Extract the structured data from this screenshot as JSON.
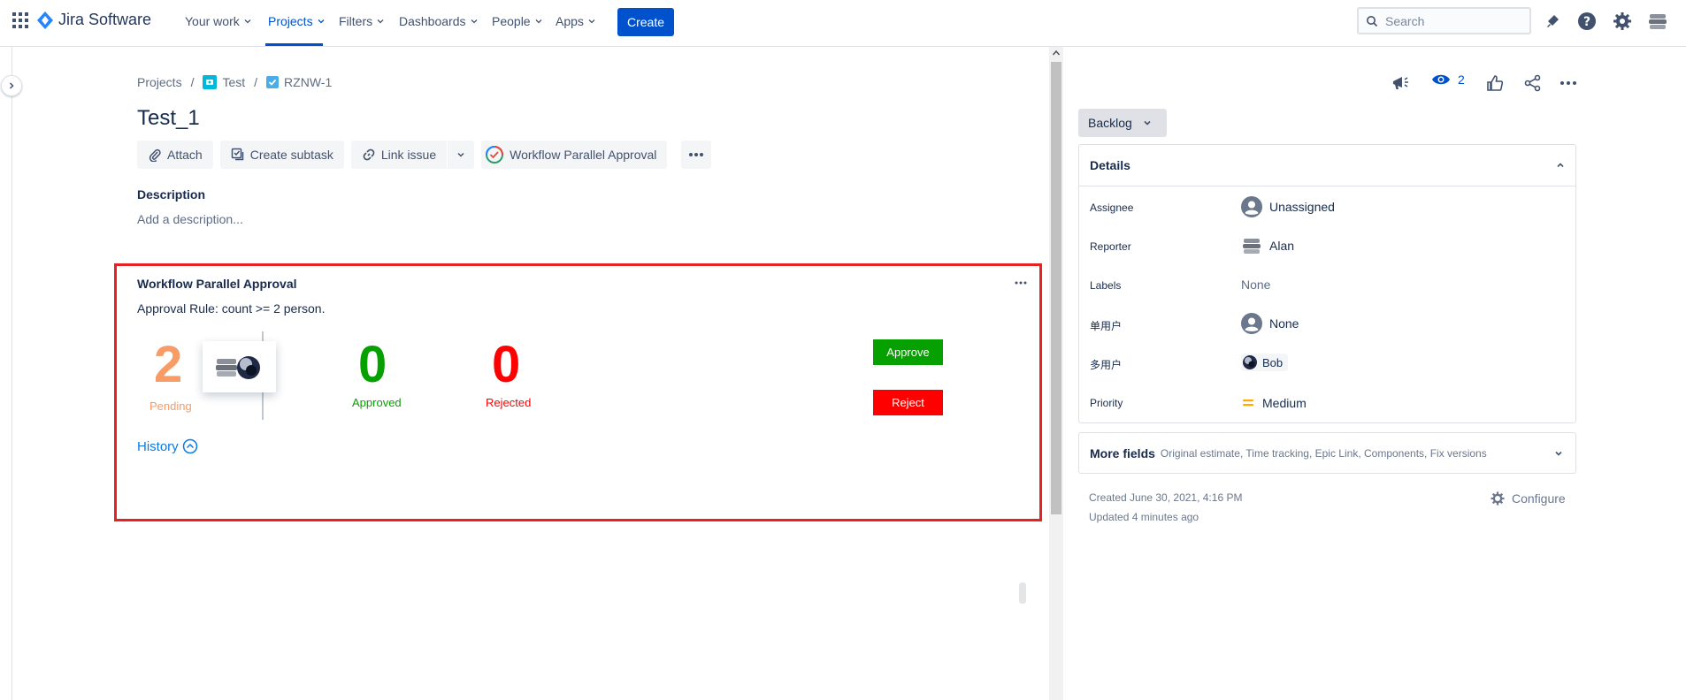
{
  "nav": {
    "logo_text": "Jira Software",
    "items": [
      {
        "label": "Your work"
      },
      {
        "label": "Projects",
        "active": true
      },
      {
        "label": "Filters"
      },
      {
        "label": "Dashboards"
      },
      {
        "label": "People"
      },
      {
        "label": "Apps"
      }
    ],
    "create_label": "Create",
    "search_placeholder": "Search"
  },
  "breadcrumb": {
    "root": "Projects",
    "project": "Test",
    "issue_key": "RZNW-1"
  },
  "issue": {
    "title": "Test_1",
    "toolbar": {
      "attach": "Attach",
      "create_subtask": "Create subtask",
      "link_issue": "Link issue",
      "workflow_app": "Workflow Parallel Approval"
    },
    "description_label": "Description",
    "description_placeholder": "Add a description..."
  },
  "approval": {
    "title": "Workflow Parallel Approval",
    "rule": "Approval Rule: count >= 2 person.",
    "pending_count": "2",
    "pending_label": "Pending",
    "approved_count": "0",
    "approved_label": "Approved",
    "rejected_count": "0",
    "rejected_label": "Rejected",
    "approve_label": "Approve",
    "reject_label": "Reject",
    "history_label": "History",
    "colors": {
      "pending": "#f79b67",
      "approved": "#06a000",
      "rejected": "#ff0000"
    }
  },
  "sidebar": {
    "watchers_count": "2",
    "status": "Backlog",
    "details_title": "Details",
    "fields": [
      {
        "label": "Assignee",
        "value": "Unassigned",
        "icon": "user-icon"
      },
      {
        "label": "Reporter",
        "value": "Alan",
        "icon": "avatar"
      },
      {
        "label": "Labels",
        "value": "None",
        "icon": ""
      },
      {
        "label": "单用户",
        "value": "None",
        "icon": "user-icon"
      },
      {
        "label": "多用户",
        "value": "Bob",
        "icon": "avatar"
      },
      {
        "label": "Priority",
        "value": "Medium",
        "icon": "priority-medium-icon"
      }
    ],
    "more_fields_title": "More fields",
    "more_fields_sub": "Original estimate, Time tracking, Epic Link, Components, Fix versions",
    "created": "Created June 30, 2021, 4:16 PM",
    "updated": "Updated 4 minutes ago",
    "configure_label": "Configure"
  }
}
